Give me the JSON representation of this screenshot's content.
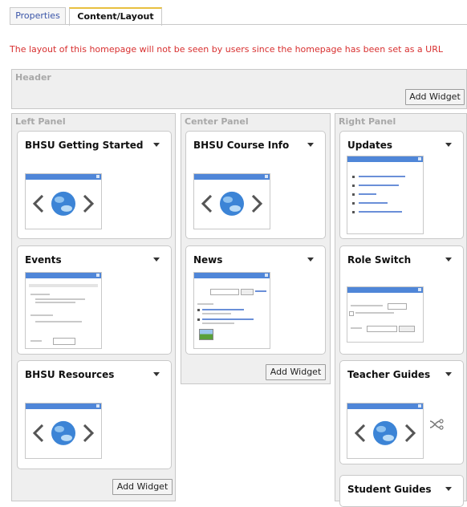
{
  "tabs": [
    {
      "label": "Properties",
      "active": false
    },
    {
      "label": "Content/Layout",
      "active": true
    }
  ],
  "notice": "The layout of this homepage will not be seen by users since the homepage has been set as a URL",
  "header_zone": {
    "title": "Header",
    "add_widget": "Add Widget"
  },
  "panels": {
    "left": {
      "title": "Left Panel",
      "add_widget": "Add Widget",
      "widgets": [
        "BHSU Getting Started",
        "Events",
        "BHSU Resources"
      ]
    },
    "center": {
      "title": "Center Panel",
      "add_widget": "Add Widget",
      "widgets": [
        "BHSU Course Info",
        "News"
      ]
    },
    "right": {
      "title": "Right Panel",
      "widgets": [
        "Updates",
        "Role Switch",
        "Teacher Guides",
        "Student Guides"
      ]
    }
  },
  "colors": {
    "notice": "#d83030",
    "tab_link": "#3a55a8",
    "thumb_bar": "#4f86d8"
  },
  "icons": {
    "widget_menu": "chevron-down-icon",
    "placeholder": "globe-icon",
    "shuffle": "shuffle-icon"
  }
}
